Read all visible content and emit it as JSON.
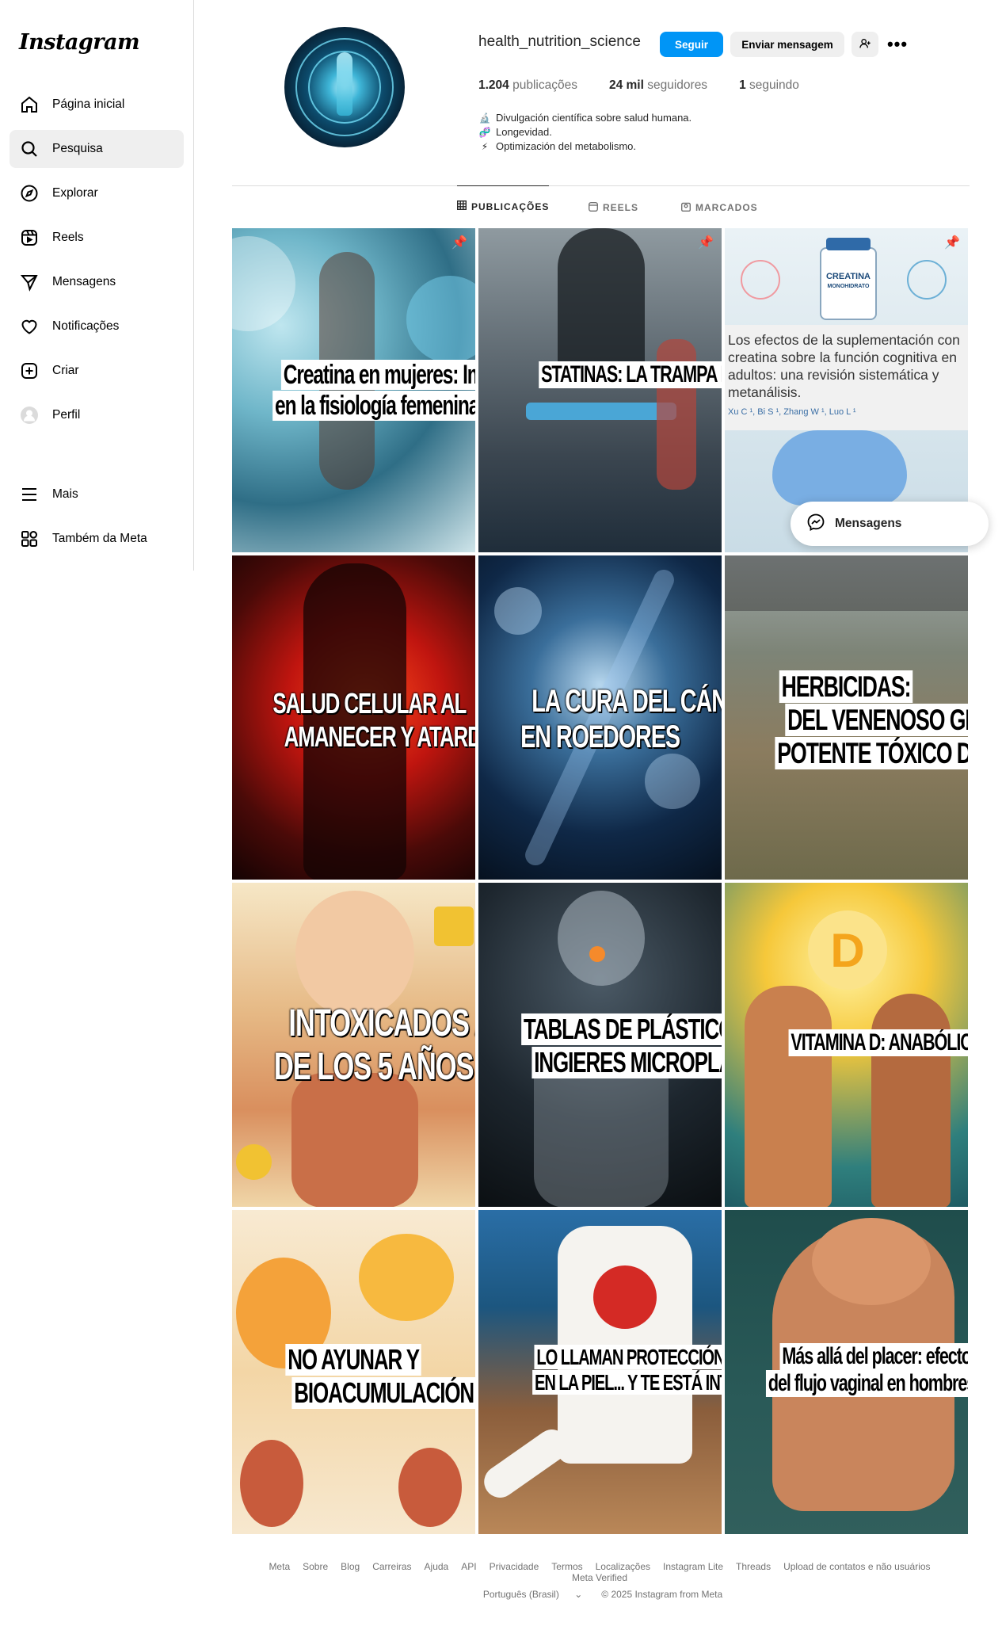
{
  "app": {
    "logo": "Instagram"
  },
  "sidebar": {
    "items": [
      {
        "label": "Página inicial",
        "icon": "home-icon"
      },
      {
        "label": "Pesquisa",
        "icon": "search-icon"
      },
      {
        "label": "Explorar",
        "icon": "compass-icon"
      },
      {
        "label": "Reels",
        "icon": "reels-icon"
      },
      {
        "label": "Mensagens",
        "icon": "send-icon"
      },
      {
        "label": "Notificações",
        "icon": "heart-icon"
      },
      {
        "label": "Criar",
        "icon": "plus-square-icon"
      },
      {
        "label": "Perfil",
        "icon": "avatar-icon"
      }
    ],
    "bottom_items": [
      {
        "label": "Mais",
        "icon": "menu-icon"
      },
      {
        "label": "Também da Meta",
        "icon": "meta-apps-icon"
      }
    ]
  },
  "profile": {
    "username": "health_nutrition_science",
    "follow_label": "Seguir",
    "message_label": "Enviar mensagem",
    "posts_count": "1.204",
    "posts_label": "publicações",
    "followers_count": "24 mil",
    "followers_label": "seguidores",
    "following_count": "1",
    "following_label": "seguindo",
    "bio": [
      {
        "emoji": "🔬",
        "text": "Divulgación científica sobre salud humana."
      },
      {
        "emoji": "🧬",
        "text": "Longevidad."
      },
      {
        "emoji": "⚡",
        "text": "Optimización del metabolismo."
      }
    ]
  },
  "tabs": [
    {
      "label": "PUBLICAÇÕES",
      "icon": "grid-icon",
      "active": true
    },
    {
      "label": "REELS",
      "icon": "reels-icon",
      "active": false
    },
    {
      "label": "MARCADOS",
      "icon": "tag-icon",
      "active": false
    }
  ],
  "posts": [
    {
      "lines": [
        "Creatina en mujeres: Impacto",
        "en la fisiología femenina"
      ],
      "pinned": true
    },
    {
      "lines": [
        "STATINAS: LA TRAMPA FARMACÉUTICA"
      ],
      "pinned": true
    },
    {
      "pinned": true,
      "article_title": [
        "Los efectos de la suplementación con",
        "creatina sobre la función cognitiva en",
        "adultos: una revisión sistemática y",
        "metanálisis."
      ],
      "article_authors": "Xu C ¹, Bi S ¹, Zhang W ¹, Luo L ¹",
      "bottle_label": [
        "CREATINA",
        "MONOHIDRATO"
      ]
    },
    {
      "lines": [
        "SALUD CELULAR AL",
        "AMANECER Y ATARDECER"
      ]
    },
    {
      "lines": [
        "LA CURA DEL CÁNCER...",
        "EN ROEDORES"
      ]
    },
    {
      "lines": [
        "HERBICIDAS:",
        "DEL VENENOSO GLIFOSATO AL",
        "POTENTE TÓXICO DIQUAT"
      ]
    },
    {
      "lines": [
        "INTOXICADOS ANTES",
        "DE LOS 5 AÑOS"
      ]
    },
    {
      "lines": [
        "TABLAS DE PLÁSTICO:",
        "INGIERES MICROPLÁSTICOS"
      ]
    },
    {
      "lines": [
        "VITAMINA D: ANABÓLICA Y REGULADORA"
      ],
      "badge": "D"
    },
    {
      "lines": [
        "NO AYUNAR Y",
        "BIOACUMULACIÓN DE TÓXICOS"
      ]
    },
    {
      "lines": [
        "LO LLAMAN PROTECCIÓN, LO APLICAS",
        "EN LA PIEL... Y TE ESTÁ INTOXICANDO"
      ]
    },
    {
      "lines": [
        "Más allá del placer: efectos biológicos",
        "del flujo vaginal en hombres"
      ]
    }
  ],
  "messages_pill": {
    "label": "Mensagens"
  },
  "footer": {
    "links": [
      "Meta",
      "Sobre",
      "Blog",
      "Carreiras",
      "Ajuda",
      "API",
      "Privacidade",
      "Termos",
      "Localizações",
      "Instagram Lite",
      "Threads",
      "Upload de contatos e não usuários",
      "Meta Verified"
    ],
    "language": "Português (Brasil)",
    "copyright": "© 2025 Instagram from Meta"
  }
}
